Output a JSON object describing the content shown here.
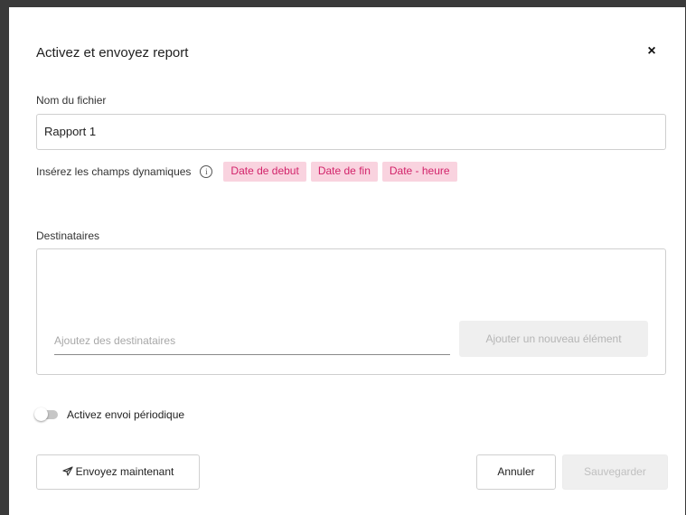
{
  "dialog": {
    "title": "Activez et envoyez report",
    "close_symbol": "×"
  },
  "filename": {
    "label": "Nom du fichier",
    "value": "Rapport 1"
  },
  "dynamic_fields": {
    "label": "Insérez les champs dynamiques",
    "info_symbol": "i",
    "chips": [
      "Date de debut",
      "Date de fin",
      "Date - heure"
    ]
  },
  "recipients": {
    "label": "Destinataires",
    "placeholder": "Ajoutez des destinataires",
    "add_button_label": "Ajouter un nouveau élément"
  },
  "periodic": {
    "label": "Activez envoi périodique",
    "enabled": false
  },
  "footer": {
    "send_now_label": "Envoyez maintenant",
    "send_icon": "send-icon",
    "cancel_label": "Annuler",
    "save_label": "Sauvegarder"
  },
  "colors": {
    "chip_bg": "#f9d3df",
    "chip_text": "#d2236a",
    "disabled_bg": "#efefef",
    "disabled_text": "#c0c0c0"
  }
}
